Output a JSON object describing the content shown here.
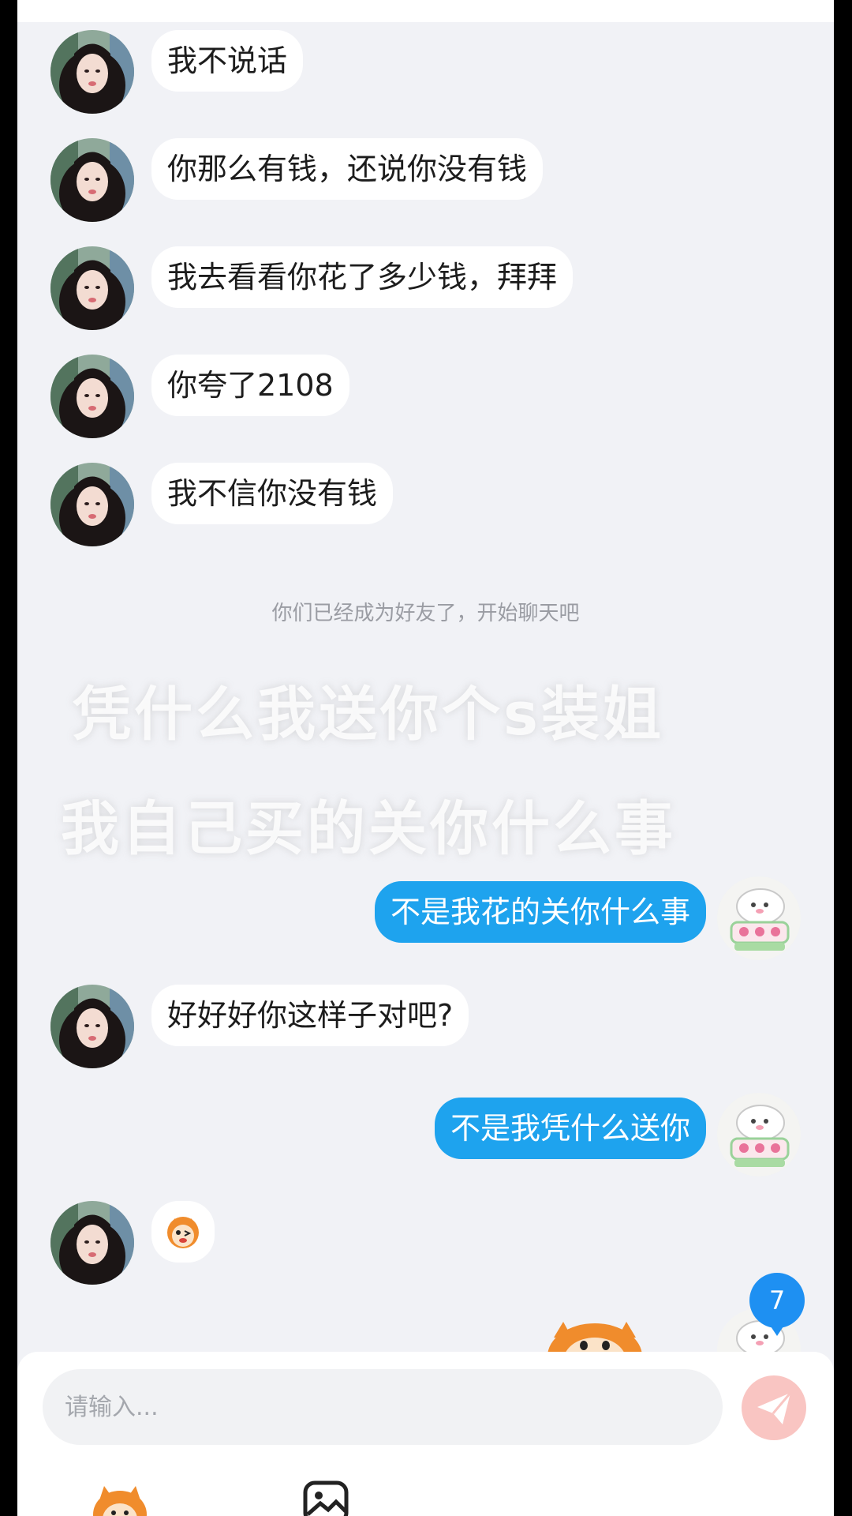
{
  "chat": {
    "messages": [
      {
        "side": "left",
        "text": "我不说话"
      },
      {
        "side": "left",
        "text": "你那么有钱，还说你没有钱"
      },
      {
        "side": "left",
        "text": "我去看看你花了多少钱，拜拜"
      },
      {
        "side": "left",
        "text": "你夸了2108"
      },
      {
        "side": "left",
        "text": "我不信你没有钱"
      },
      {
        "side": "right",
        "text": "不是我花的关你什么事"
      },
      {
        "side": "left",
        "text": "好好好你这样子对吧?"
      },
      {
        "side": "right",
        "text": "不是我凭什么送你"
      },
      {
        "side": "left",
        "text": ""
      }
    ],
    "system_note": "你们已经成为好友了，开始聊天吧",
    "unread_count": "7"
  },
  "overlay": {
    "line1": "凭什么我送你个s装姐",
    "line2": "我自己买的关你什么事"
  },
  "input_bar": {
    "placeholder": "请输入..."
  },
  "colors": {
    "background": "#f1f2f6",
    "incoming_bubble": "#ffffff",
    "outgoing_bubble": "#1ea3ee",
    "badge": "#1e90f2",
    "send_button": "#f9c5c2"
  },
  "icons": {
    "send": "paper-plane-icon",
    "emoji_tab": "mascot-emoji-icon",
    "image_tab": "image-icon",
    "sticker": "mascot-sticker"
  }
}
